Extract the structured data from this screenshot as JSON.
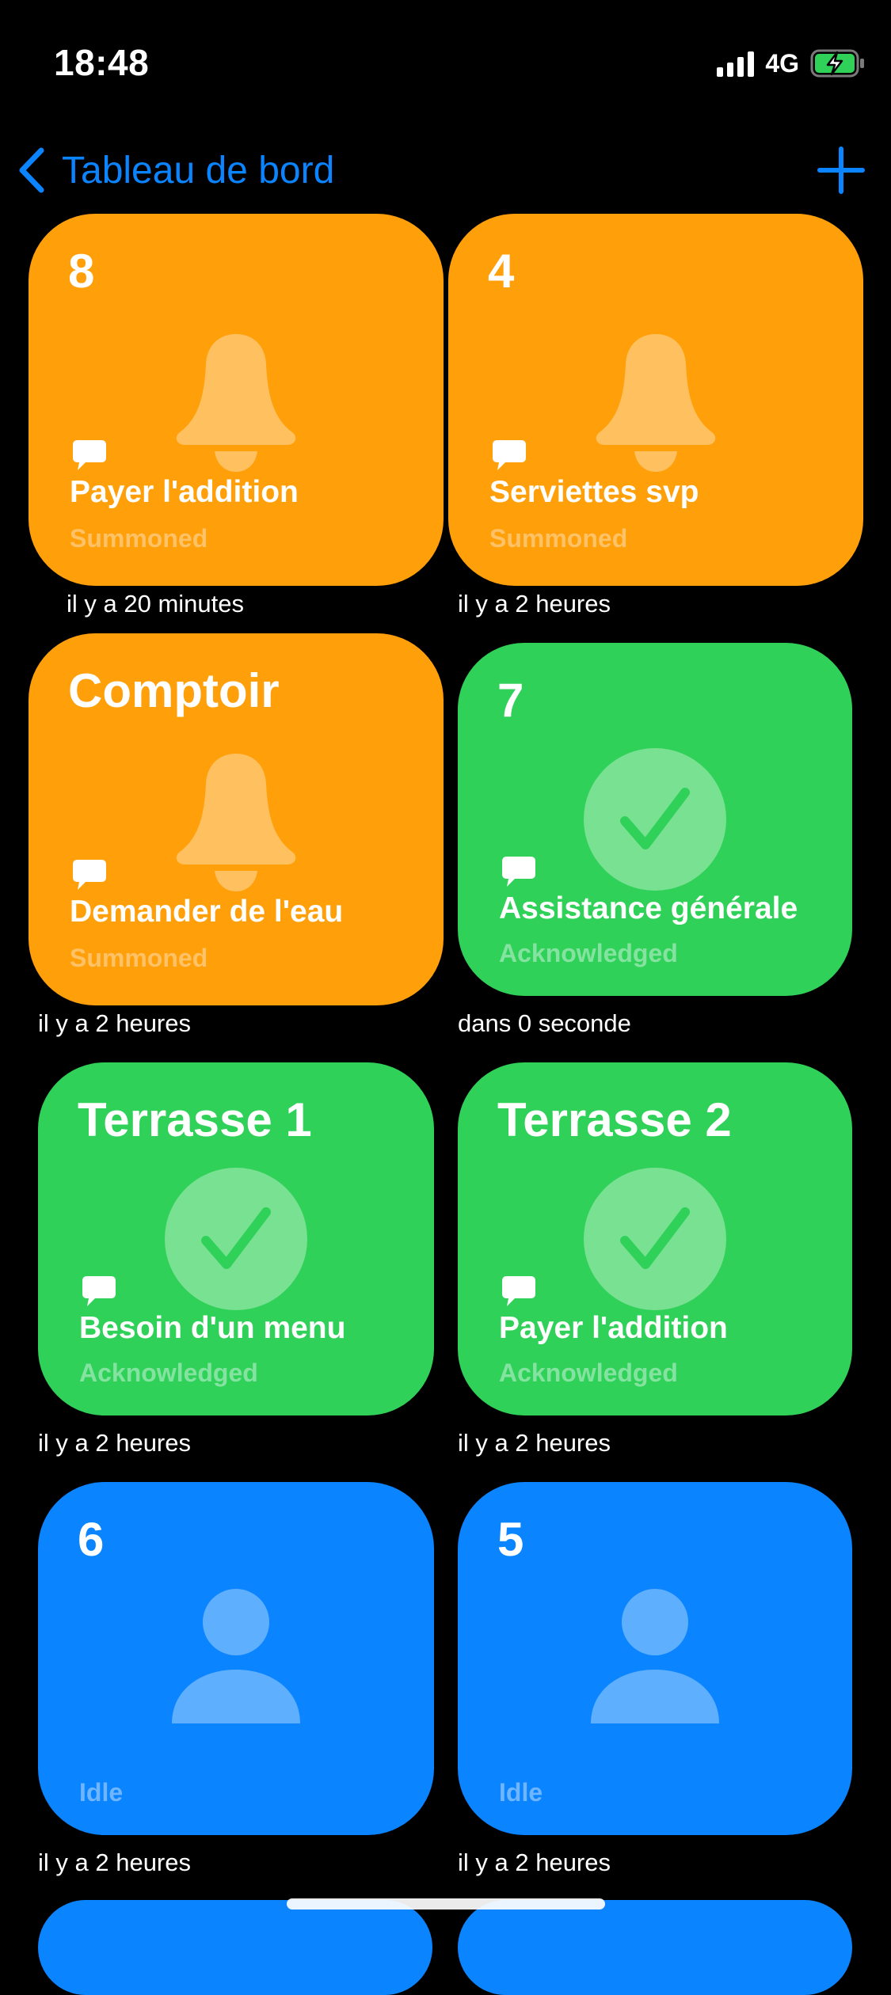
{
  "status_bar": {
    "time": "18:48",
    "network": "4G",
    "battery_state": "charging"
  },
  "nav": {
    "back_label": "Tableau de bord",
    "add_icon": "plus-icon",
    "accent_color": "#0a84ff"
  },
  "colors": {
    "summoned": "#ff9f0a",
    "acknowledged": "#30d158",
    "idle": "#0a84ff",
    "background": "#000000"
  },
  "tiles": [
    {
      "table": "8",
      "status": "summoned",
      "icon": "bell-icon",
      "message": "Payer l'addition",
      "state_label": "Summoned",
      "time_ago": "il y a 20 minutes"
    },
    {
      "table": "4",
      "status": "summoned",
      "icon": "bell-icon",
      "message": "Serviettes svp",
      "state_label": "Summoned",
      "time_ago": "il y a 2 heures"
    },
    {
      "table": "Comptoir",
      "status": "summoned",
      "icon": "bell-icon",
      "message": "Demander de l'eau",
      "state_label": "Summoned",
      "time_ago": "il y a 2 heures"
    },
    {
      "table": "7",
      "status": "acknowledged",
      "icon": "checkmark-icon",
      "message": "Assistance générale",
      "state_label": "Acknowledged",
      "time_ago": "dans 0 seconde"
    },
    {
      "table": "Terrasse 1",
      "status": "acknowledged",
      "icon": "checkmark-icon",
      "message": "Besoin d'un menu",
      "state_label": "Acknowledged",
      "time_ago": "il y a 2 heures"
    },
    {
      "table": "Terrasse 2",
      "status": "acknowledged",
      "icon": "checkmark-icon",
      "message": "Payer l'addition",
      "state_label": "Acknowledged",
      "time_ago": "il y a 2 heures"
    },
    {
      "table": "6",
      "status": "idle",
      "icon": "person-icon",
      "message": "",
      "state_label": "Idle",
      "time_ago": "il y a 2 heures"
    },
    {
      "table": "5",
      "status": "idle",
      "icon": "person-icon",
      "message": "",
      "state_label": "Idle",
      "time_ago": "il y a 2 heures"
    }
  ]
}
